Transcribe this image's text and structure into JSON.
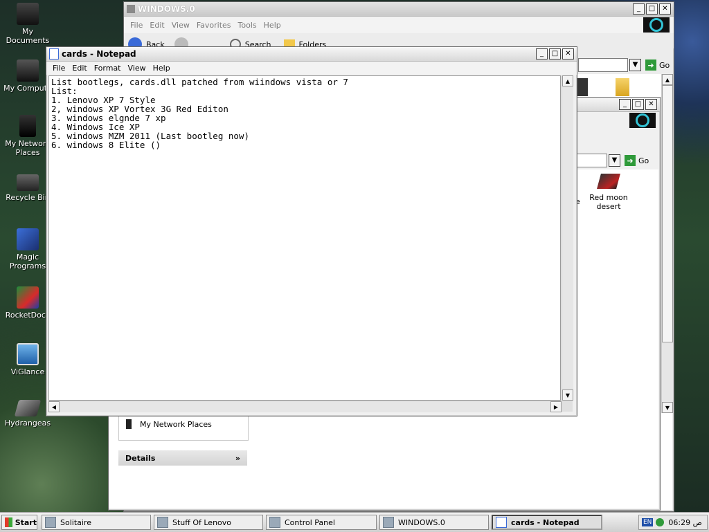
{
  "desktop": {
    "icons": [
      {
        "label": "My Documents"
      },
      {
        "label": "My Compute"
      },
      {
        "label": "My Network Places"
      },
      {
        "label": "Recycle Bin"
      },
      {
        "label": "Magic Programs"
      },
      {
        "label": "RocketDock"
      },
      {
        "label": "ViGlance"
      },
      {
        "label": "Hydrangeas"
      }
    ]
  },
  "explorer_back": {
    "title": "WINDOWS.0",
    "menu": [
      "File",
      "Edit",
      "View",
      "Favorites",
      "Tools",
      "Help"
    ],
    "toolbar": {
      "back": "Back",
      "search": "Search",
      "folders": "Folders"
    },
    "go_label": "Go"
  },
  "explorer_mid": {
    "go_label": "Go",
    "item_partial": "e",
    "item_label": "Red moon desert",
    "sidebar": {
      "network_places": "My Network Places",
      "details_header": "Details"
    }
  },
  "notepad": {
    "title": "cards - Notepad",
    "menu": [
      "File",
      "Edit",
      "Format",
      "View",
      "Help"
    ],
    "lines": [
      "List bootlegs, cards.dll patched from wiindows vista or 7",
      "",
      "List:",
      "1. Lenovo XP 7 Style",
      "2, windows XP Vortex 3G Red Editon",
      "3. windows elgnde 7 xp",
      "4. Windows Ice XP",
      "5. windows MZM 2011 (Last bootleg now)",
      "6. windows 8 Elite ()"
    ]
  },
  "taskbar": {
    "start": "Start",
    "items": [
      {
        "label": "Solitaire"
      },
      {
        "label": "Stuff Of Lenovo"
      },
      {
        "label": "Control Panel"
      },
      {
        "label": "WINDOWS.0"
      },
      {
        "label": "cards - Notepad",
        "active": true
      }
    ],
    "tray": {
      "lang": "EN",
      "clock": "06:29 ص"
    }
  }
}
